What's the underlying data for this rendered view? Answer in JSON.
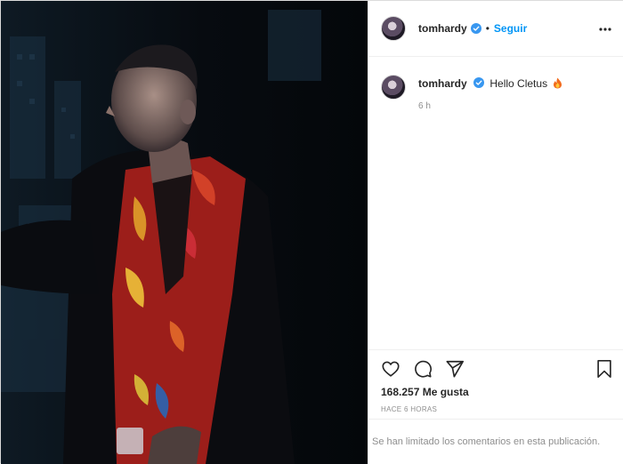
{
  "post": {
    "author": "tomhardy",
    "verified": true,
    "separator": "•",
    "follow_label": "Seguir",
    "more_icon": "more-horizontal-icon",
    "caption_username": "tomhardy",
    "caption_text": "Hello Cletus",
    "caption_emoji": "fire-emoji-icon",
    "caption_time": "6 h",
    "likes": "168.257 Me gusta",
    "posted_ago": "HACE 6 HORAS",
    "comments_notice": "Se han limitado los comentarios en esta publicación."
  },
  "actions": {
    "like_icon": "heart-icon",
    "comment_icon": "comment-icon",
    "share_icon": "paper-plane-icon",
    "save_icon": "bookmark-icon"
  },
  "colors": {
    "accent": "#0095f6",
    "verified": "#3897f0",
    "muted": "#8e8e8e",
    "text": "#262626",
    "photo_bg": "#05080c"
  }
}
